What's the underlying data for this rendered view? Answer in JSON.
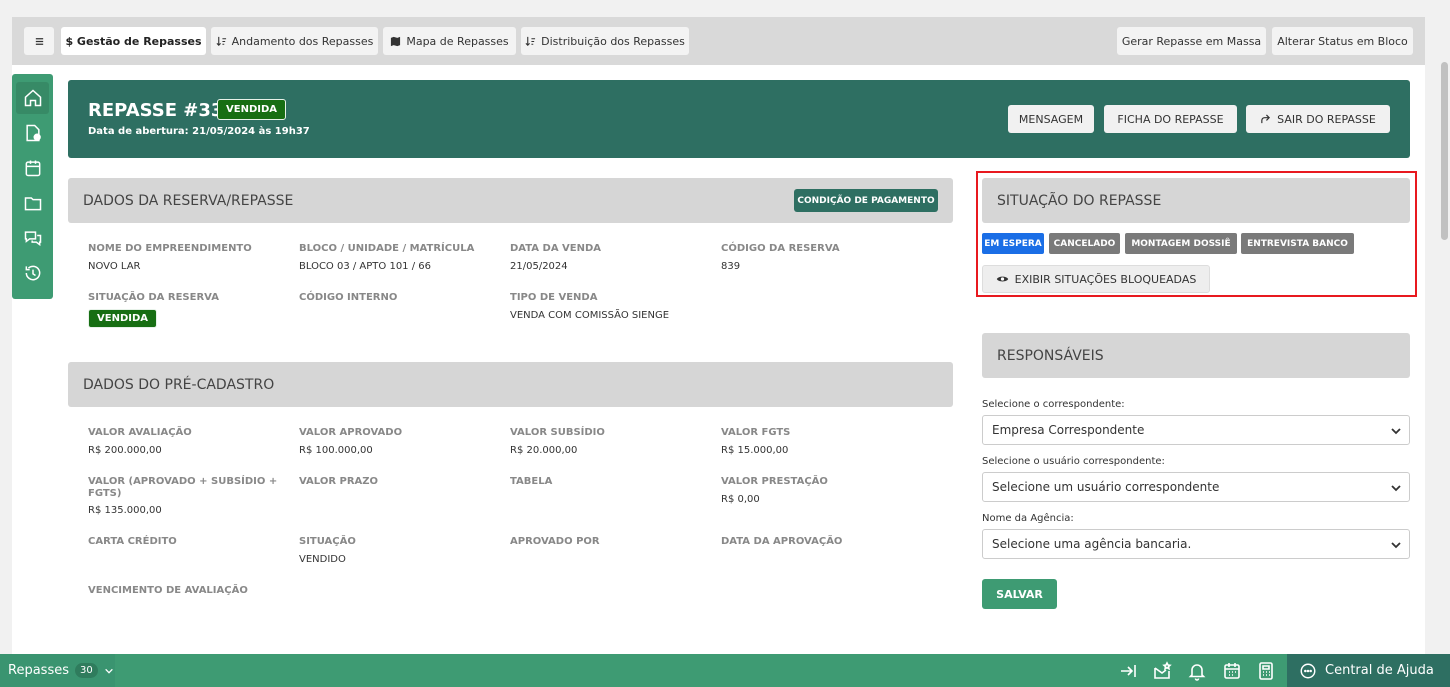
{
  "toolbar": {
    "menu_icon": "hamburger-icon",
    "tabs": [
      {
        "label": "$ Gestão de Repasses",
        "active": true
      },
      {
        "label": "Andamento dos Repasses",
        "icon": "sort-icon"
      },
      {
        "label": "Mapa de Repasses",
        "icon": "map-icon"
      },
      {
        "label": "Distribuição dos Repasses",
        "icon": "sort-icon"
      }
    ],
    "actions": [
      "Gerar Repasse em Massa",
      "Alterar Status em Bloco"
    ]
  },
  "rail": [
    "home-icon",
    "document-icon",
    "calendar-icon",
    "folder-icon",
    "chat-icon",
    "history-icon"
  ],
  "header": {
    "title": "REPASSE #339",
    "badge": "VENDIDA",
    "subtitle": "Data de abertura: 21/05/2024 às 19h37",
    "buttons": [
      "MENSAGEM",
      "FICHA DO REPASSE",
      "SAIR DO REPASSE"
    ]
  },
  "reserva": {
    "title": "DADOS DA RESERVA/REPASSE",
    "button": "CONDIÇÃO DE PAGAMENTO",
    "fields": [
      {
        "label": "NOME DO EMPREENDIMENTO",
        "value": "NOVO LAR"
      },
      {
        "label": "BLOCO / UNIDADE / MATRÍCULA",
        "value": "BLOCO 03 / APTO 101 / 66"
      },
      {
        "label": "DATA DA VENDA",
        "value": "21/05/2024"
      },
      {
        "label": "CÓDIGO DA RESERVA",
        "value": "839"
      },
      {
        "label": "SITUAÇÃO DA RESERVA",
        "value": "VENDIDA"
      },
      {
        "label": "CÓDIGO INTERNO",
        "value": ""
      },
      {
        "label": "TIPO DE VENDA",
        "value": "VENDA COM COMISSÃO SIENGE"
      }
    ]
  },
  "precadastro": {
    "title": "DADOS DO PRÉ-CADASTRO",
    "fields": [
      {
        "label": "VALOR AVALIAÇÃO",
        "value": "R$ 200.000,00"
      },
      {
        "label": "VALOR APROVADO",
        "value": "R$ 100.000,00"
      },
      {
        "label": "VALOR SUBSÍDIO",
        "value": "R$ 20.000,00"
      },
      {
        "label": "VALOR FGTS",
        "value": "R$ 15.000,00"
      },
      {
        "label": "VALOR (APROVADO + SUBSÍDIO + FGTS)",
        "value": "R$ 135.000,00"
      },
      {
        "label": "VALOR PRAZO",
        "value": ""
      },
      {
        "label": "TABELA",
        "value": ""
      },
      {
        "label": "VALOR PRESTAÇÃO",
        "value": "R$ 0,00"
      },
      {
        "label": "CARTA CRÉDITO",
        "value": ""
      },
      {
        "label": "SITUAÇÃO",
        "value": "VENDIDO"
      },
      {
        "label": "APROVADO POR",
        "value": ""
      },
      {
        "label": "DATA DA APROVAÇÃO",
        "value": ""
      },
      {
        "label": "VENCIMENTO DE AVALIAÇÃO",
        "value": ""
      }
    ]
  },
  "situacao": {
    "title": "SITUAÇÃO DO REPASSE",
    "tags": [
      {
        "label": "EM ESPERA",
        "color": "#1a6ee6"
      },
      {
        "label": "CANCELADO",
        "color": "#7a7a7a"
      },
      {
        "label": "MONTAGEM DOSSIÊ",
        "color": "#7a7a7a"
      },
      {
        "label": "ENTREVISTA BANCO",
        "color": "#7a7a7a"
      }
    ],
    "blocked_button": "EXIBIR SITUAÇÕES BLOQUEADAS"
  },
  "responsaveis": {
    "title": "RESPONSÁVEIS",
    "correspondente_label": "Selecione o correspondente:",
    "correspondente_value": "Empresa Correspondente",
    "usuario_label": "Selecione o usuário correspondente:",
    "usuario_value": "Selecione um usuário correspondente",
    "agencia_label": "Nome da Agência:",
    "agencia_value": "Selecione uma agência bancaria.",
    "save": "SALVAR"
  },
  "bottombar": {
    "label": "Repasses",
    "count": "30",
    "help": "Central de Ajuda"
  },
  "colors": {
    "primary": "#2e6f62",
    "accent": "#3e9b73",
    "badge": "#176e13",
    "highlight": "#e8191f"
  }
}
